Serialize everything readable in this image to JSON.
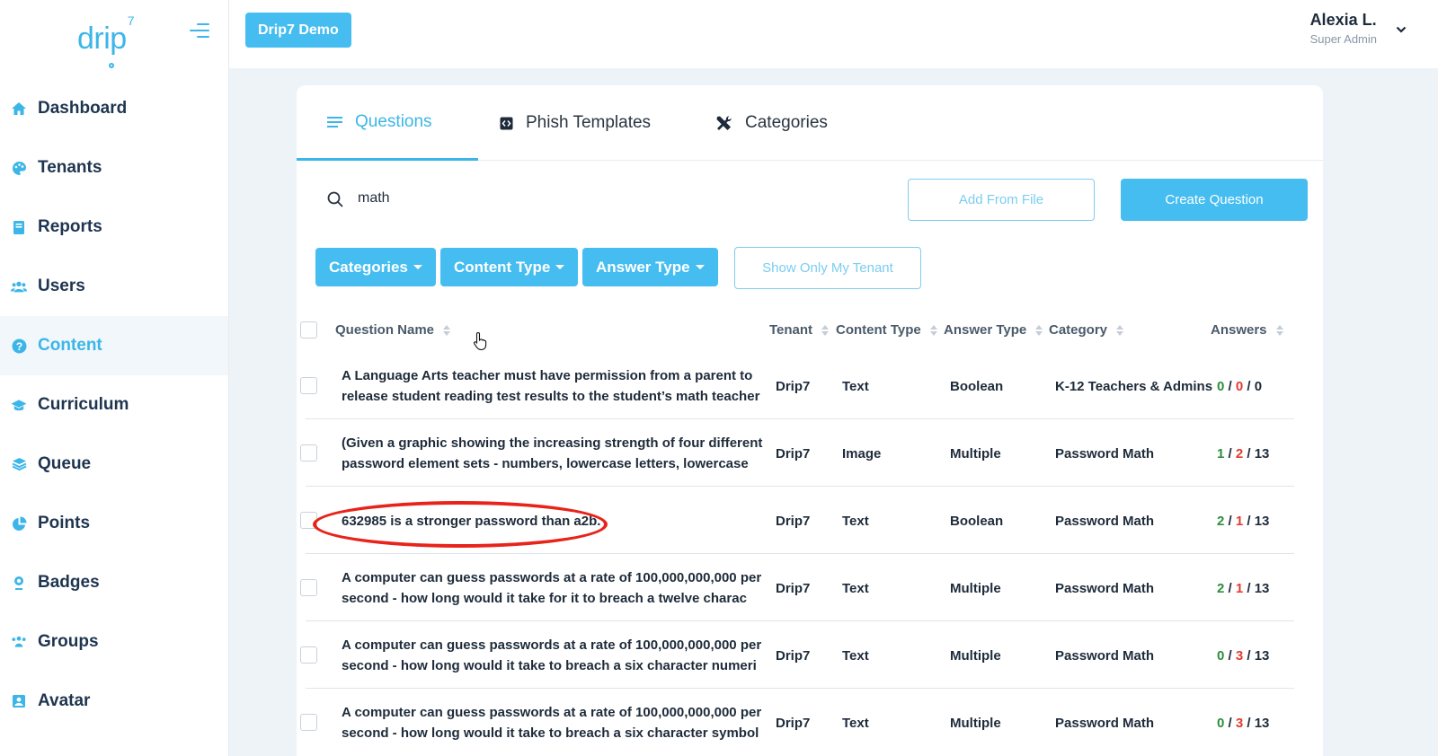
{
  "logo": {
    "text": "drip",
    "superscript": "7"
  },
  "sidebar": {
    "items": [
      {
        "label": "Dashboard",
        "icon": "home-icon",
        "active": false
      },
      {
        "label": "Tenants",
        "icon": "palette-icon",
        "active": false
      },
      {
        "label": "Reports",
        "icon": "book-icon",
        "active": false
      },
      {
        "label": "Users",
        "icon": "users-icon",
        "active": false
      },
      {
        "label": "Content",
        "icon": "question-circle-icon",
        "active": true
      },
      {
        "label": "Curriculum",
        "icon": "graduation-cap-icon",
        "active": false
      },
      {
        "label": "Queue",
        "icon": "layers-icon",
        "active": false
      },
      {
        "label": "Points",
        "icon": "pie-chart-icon",
        "active": false
      },
      {
        "label": "Badges",
        "icon": "badge-icon",
        "active": false
      },
      {
        "label": "Groups",
        "icon": "group-icon",
        "active": false
      },
      {
        "label": "Avatar",
        "icon": "portrait-icon",
        "active": false
      }
    ]
  },
  "header": {
    "tenant_button": "Drip7 Demo",
    "user_name": "Alexia L.",
    "user_role": "Super Admin"
  },
  "tabs": [
    {
      "label": "Questions",
      "icon": "list-icon",
      "active": true
    },
    {
      "label": "Phish Templates",
      "icon": "code-square-icon",
      "active": false
    },
    {
      "label": "Categories",
      "icon": "tools-icon",
      "active": false
    }
  ],
  "search": {
    "value": "math"
  },
  "actions": {
    "add_from_file": "Add From File",
    "create_question": "Create Question"
  },
  "filters": {
    "categories": "Categories",
    "content_type": "Content Type",
    "answer_type": "Answer Type",
    "show_only_my_tenant": "Show Only My Tenant"
  },
  "table": {
    "columns": {
      "question_name": "Question Name",
      "tenant": "Tenant",
      "content_type": "Content Type",
      "answer_type": "Answer Type",
      "category": "Category",
      "answers": "Answers"
    },
    "rows": [
      {
        "line1": "A Language Arts teacher must have permission from a parent to",
        "line2": "release student reading test results to the student’s math teacher",
        "tenant": "Drip7",
        "content_type": "Text",
        "answer_type": "Boolean",
        "category": "K-12 Teachers & Admins",
        "correct": "0",
        "wrong": "0",
        "total": "0"
      },
      {
        "line1": "(Given a graphic showing the increasing strength of four different",
        "line2": "password element sets - numbers, lowercase letters, lowercase",
        "tenant": "Drip7",
        "content_type": "Image",
        "answer_type": "Multiple",
        "category": "Password Math",
        "correct": "1",
        "wrong": "2",
        "total": "13"
      },
      {
        "line1": "632985 is a stronger password than a2b.",
        "line2": "",
        "tenant": "Drip7",
        "content_type": "Text",
        "answer_type": "Boolean",
        "category": "Password Math",
        "correct": "2",
        "wrong": "1",
        "total": "13"
      },
      {
        "line1": "A computer can guess passwords at a rate of 100,000,000,000 per",
        "line2": "second - how long would it take for it to breach a twelve charac",
        "tenant": "Drip7",
        "content_type": "Text",
        "answer_type": "Multiple",
        "category": "Password Math",
        "correct": "2",
        "wrong": "1",
        "total": "13"
      },
      {
        "line1": "A computer can guess passwords at a rate of 100,000,000,000 per",
        "line2": "second - how long would it take to breach a six character numeri",
        "tenant": "Drip7",
        "content_type": "Text",
        "answer_type": "Multiple",
        "category": "Password Math",
        "correct": "0",
        "wrong": "3",
        "total": "13"
      },
      {
        "line1": "A computer can guess passwords at a rate of 100,000,000,000 per",
        "line2": "second - how long would it take to breach a six character symbol",
        "tenant": "Drip7",
        "content_type": "Text",
        "answer_type": "Multiple",
        "category": "Password Math",
        "correct": "0",
        "wrong": "3",
        "total": "13"
      }
    ]
  },
  "colors": {
    "accent": "#3cb6e8",
    "correct": "#2a8f3a",
    "wrong": "#e33a2f",
    "annotation": "#e8231a"
  }
}
